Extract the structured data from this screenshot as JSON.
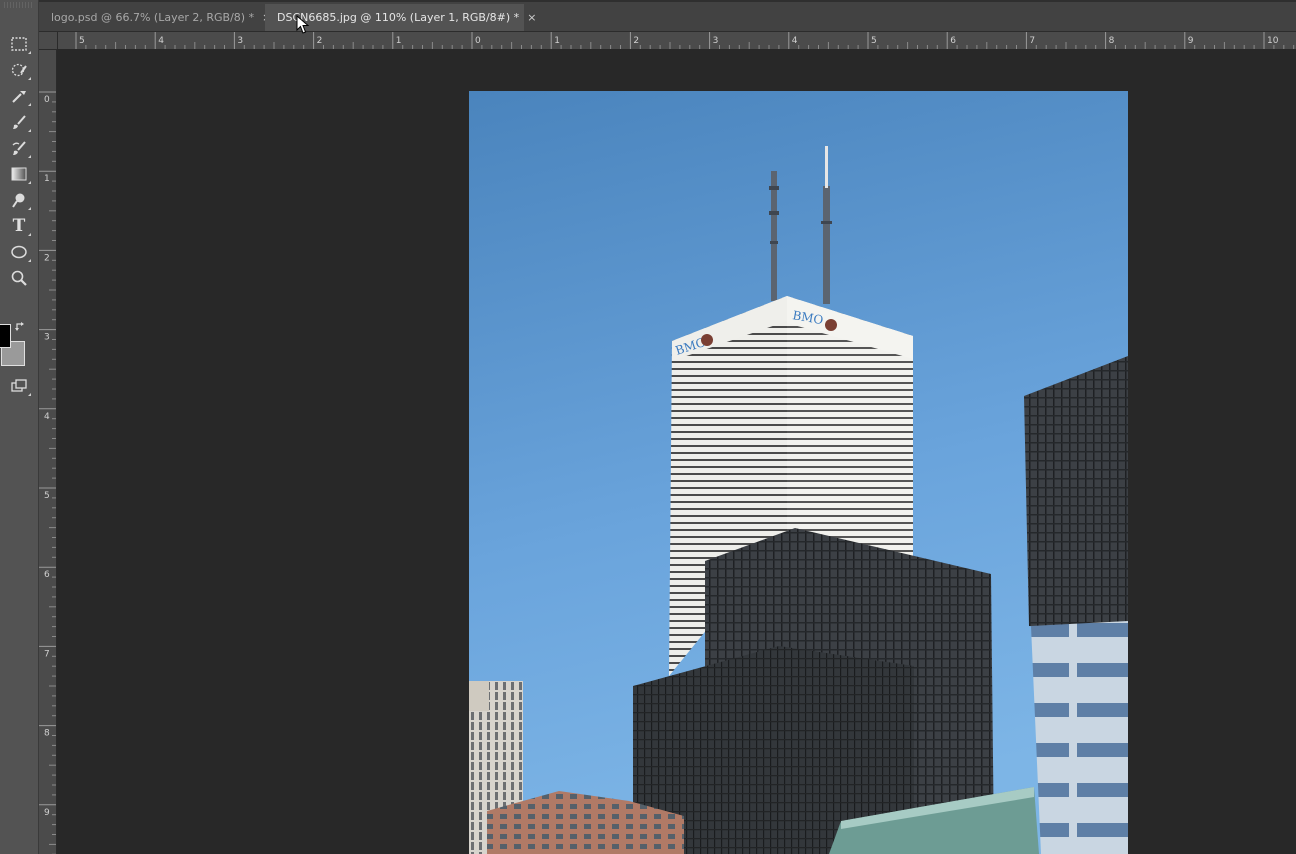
{
  "tabs": [
    {
      "title": "logo.psd @ 66.7% (Layer 2, RGB/8) *",
      "close": "×",
      "active": false
    },
    {
      "title": "DSCN6685.jpg @ 110% (Layer 1, RGB/8#) *",
      "close": "×",
      "active": true
    }
  ],
  "tools": [
    {
      "name": "rectangular-marquee-icon"
    },
    {
      "name": "quick-selection-icon"
    },
    {
      "name": "eyedropper-icon"
    },
    {
      "name": "brush-icon"
    },
    {
      "name": "history-brush-icon"
    },
    {
      "name": "gradient-icon"
    },
    {
      "name": "dodge-icon"
    },
    {
      "name": "type-icon",
      "glyph": "T"
    },
    {
      "name": "ellipse-icon"
    },
    {
      "name": "zoom-icon"
    }
  ],
  "ruler_h_labels": [
    "5",
    "4",
    "3",
    "2",
    "1",
    "0",
    "1",
    "2",
    "3",
    "4",
    "5",
    "6",
    "7",
    "8",
    "9",
    "10"
  ],
  "ruler_v_labels": [
    "0",
    "1",
    "2",
    "3",
    "4",
    "5",
    "6",
    "7",
    "8",
    "9"
  ],
  "photo": {
    "sign": "BMO",
    "colors": {
      "sky_top": "#4a84bd",
      "sky_bottom": "#7bb3e5",
      "tower": "#eeeeea",
      "dark_glass": "#2e3033"
    }
  },
  "colors": {
    "foreground": "#000000",
    "background": "#9a9a9a"
  }
}
